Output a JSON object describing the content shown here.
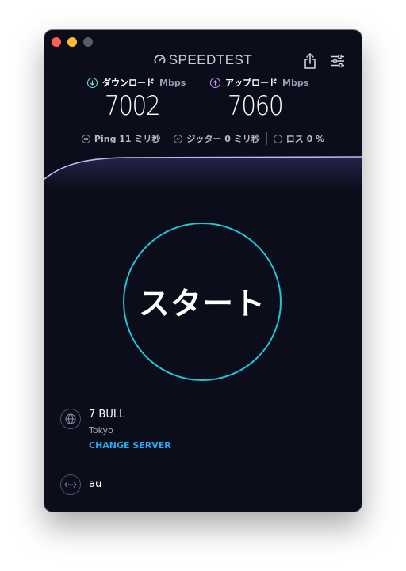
{
  "app": {
    "logo_text": "SPEEDTEST"
  },
  "download": {
    "label": "ダウンロード",
    "unit": "Mbps",
    "value": "7002"
  },
  "upload": {
    "label": "アップロード",
    "unit": "Mbps",
    "value": "7060"
  },
  "stats": {
    "ping": "Ping 11 ミリ秒",
    "jitter": "ジッター 0 ミリ秒",
    "loss": "ロス 0 %"
  },
  "start_button": {
    "label": "スタート"
  },
  "server": {
    "name": "7 BULL",
    "city": "Tokyo",
    "change_label": "CHANGE SERVER"
  },
  "isp": {
    "name": "au"
  },
  "colors": {
    "background": "#0b0d1b",
    "accent_cyan": "#22c4d2",
    "download_accent": "#6fe0d8",
    "upload_accent": "#c69cff",
    "link": "#28a9f0"
  },
  "icons": {
    "share": "share-icon",
    "settings": "sliders-icon",
    "server": "globe-icon",
    "isp": "network-icon"
  }
}
